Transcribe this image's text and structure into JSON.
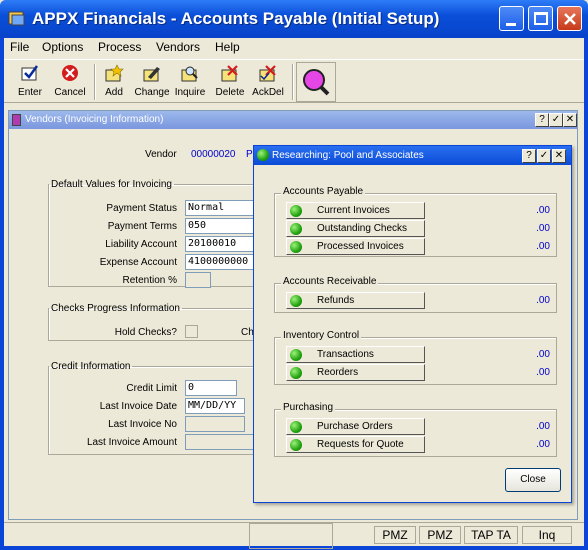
{
  "window": {
    "title": "APPX Financials - Accounts Payable (Initial Setup)"
  },
  "menu": [
    "File",
    "Options",
    "Process",
    "Vendors",
    "Help"
  ],
  "toolbar": [
    {
      "label": "Enter",
      "icon": "enter-icon"
    },
    {
      "label": "Cancel",
      "icon": "cancel-icon"
    },
    {
      "label": "Add",
      "icon": "add-icon"
    },
    {
      "label": "Change",
      "icon": "change-icon"
    },
    {
      "label": "Inquire",
      "icon": "inquire-icon"
    },
    {
      "label": "Delete",
      "icon": "delete-icon"
    },
    {
      "label": "AckDel",
      "icon": "ackdel-icon"
    }
  ],
  "vendors": {
    "title": "Vendors (Invoicing Information)",
    "vendor_label": "Vendor",
    "vendor_value": "00000020",
    "vendor_name_partial": "P",
    "defaults": {
      "legend": "Default Values for Invoicing",
      "payment_status_label": "Payment Status",
      "payment_status": "Normal",
      "payment_terms_label": "Payment Terms",
      "payment_terms": "050",
      "liability_label": "Liability Account",
      "liability": "20100010",
      "expense_label": "Expense Account",
      "expense": "4100000000",
      "retention_label": "Retention %"
    },
    "checks": {
      "legend": "Checks Progress Information",
      "hold_label": "Hold Checks?",
      "partial_label": "Che"
    },
    "credit": {
      "legend": "Credit Information",
      "limit_label": "Credit Limit",
      "limit": "0",
      "last_date_label": "Last Invoice Date",
      "last_date": "MM/DD/YY",
      "last_no_label": "Last Invoice No",
      "last_amount_label": "Last Invoice Amount"
    }
  },
  "research": {
    "title": "Researching: Pool and Associates",
    "groups": [
      {
        "name": "Accounts Payable",
        "items": [
          {
            "label": "Current Invoices",
            "value": ".00"
          },
          {
            "label": "Outstanding Checks",
            "value": ".00"
          },
          {
            "label": "Processed Invoices",
            "value": ".00"
          }
        ]
      },
      {
        "name": "Accounts Receivable",
        "items": [
          {
            "label": "Refunds",
            "value": ".00"
          }
        ]
      },
      {
        "name": "Inventory Control",
        "items": [
          {
            "label": "Transactions",
            "value": ".00"
          },
          {
            "label": "Reorders",
            "value": ".00"
          }
        ]
      },
      {
        "name": "Purchasing",
        "items": [
          {
            "label": "Purchase Orders",
            "value": ".00"
          },
          {
            "label": "Requests for Quote",
            "value": ".00"
          }
        ]
      }
    ],
    "close_label": "Close"
  },
  "status": [
    "PMZ",
    "PMZ",
    "TAP TA",
    "Inq"
  ]
}
